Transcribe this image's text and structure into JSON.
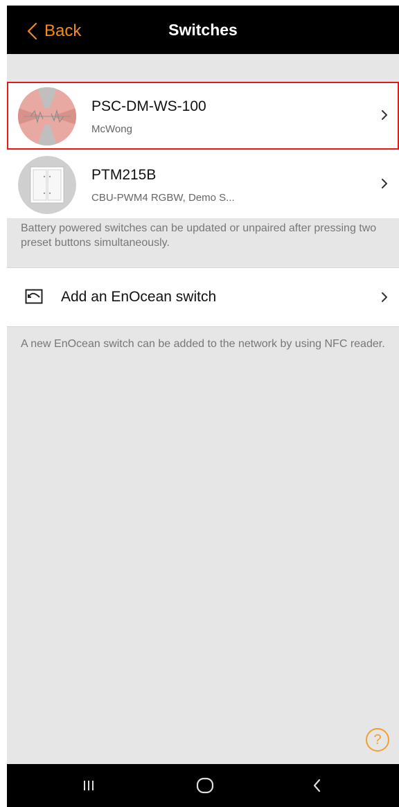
{
  "header": {
    "back_label": "Back",
    "title": "Switches"
  },
  "switches": [
    {
      "name": "PSC-DM-WS-100",
      "subtitle": "McWong",
      "thumb_icon": "dimmer-switch-icon",
      "selected": true
    },
    {
      "name": "PTM215B",
      "subtitle": "CBU-PWM4 RGBW, Demo S...",
      "thumb_icon": "wall-switch-icon",
      "selected": false
    }
  ],
  "battery_note": "Battery powered switches can be updated or unpaired after pressing two preset buttons simultaneously.",
  "add_switch": {
    "label": "Add an EnOcean switch",
    "icon": "switch-outline-icon"
  },
  "nfc_note": "A new EnOcean switch can be added to the network by using NFC reader.",
  "help": {
    "symbol": "?",
    "icon": "help-icon"
  },
  "navbar": {
    "recents_icon": "recents-icon",
    "home_icon": "home-icon",
    "back_icon": "nav-back-icon"
  },
  "colors": {
    "accent": "#f08c1e",
    "selection": "#e11b1b",
    "background": "#e6e6e6",
    "bar": "#000000"
  }
}
